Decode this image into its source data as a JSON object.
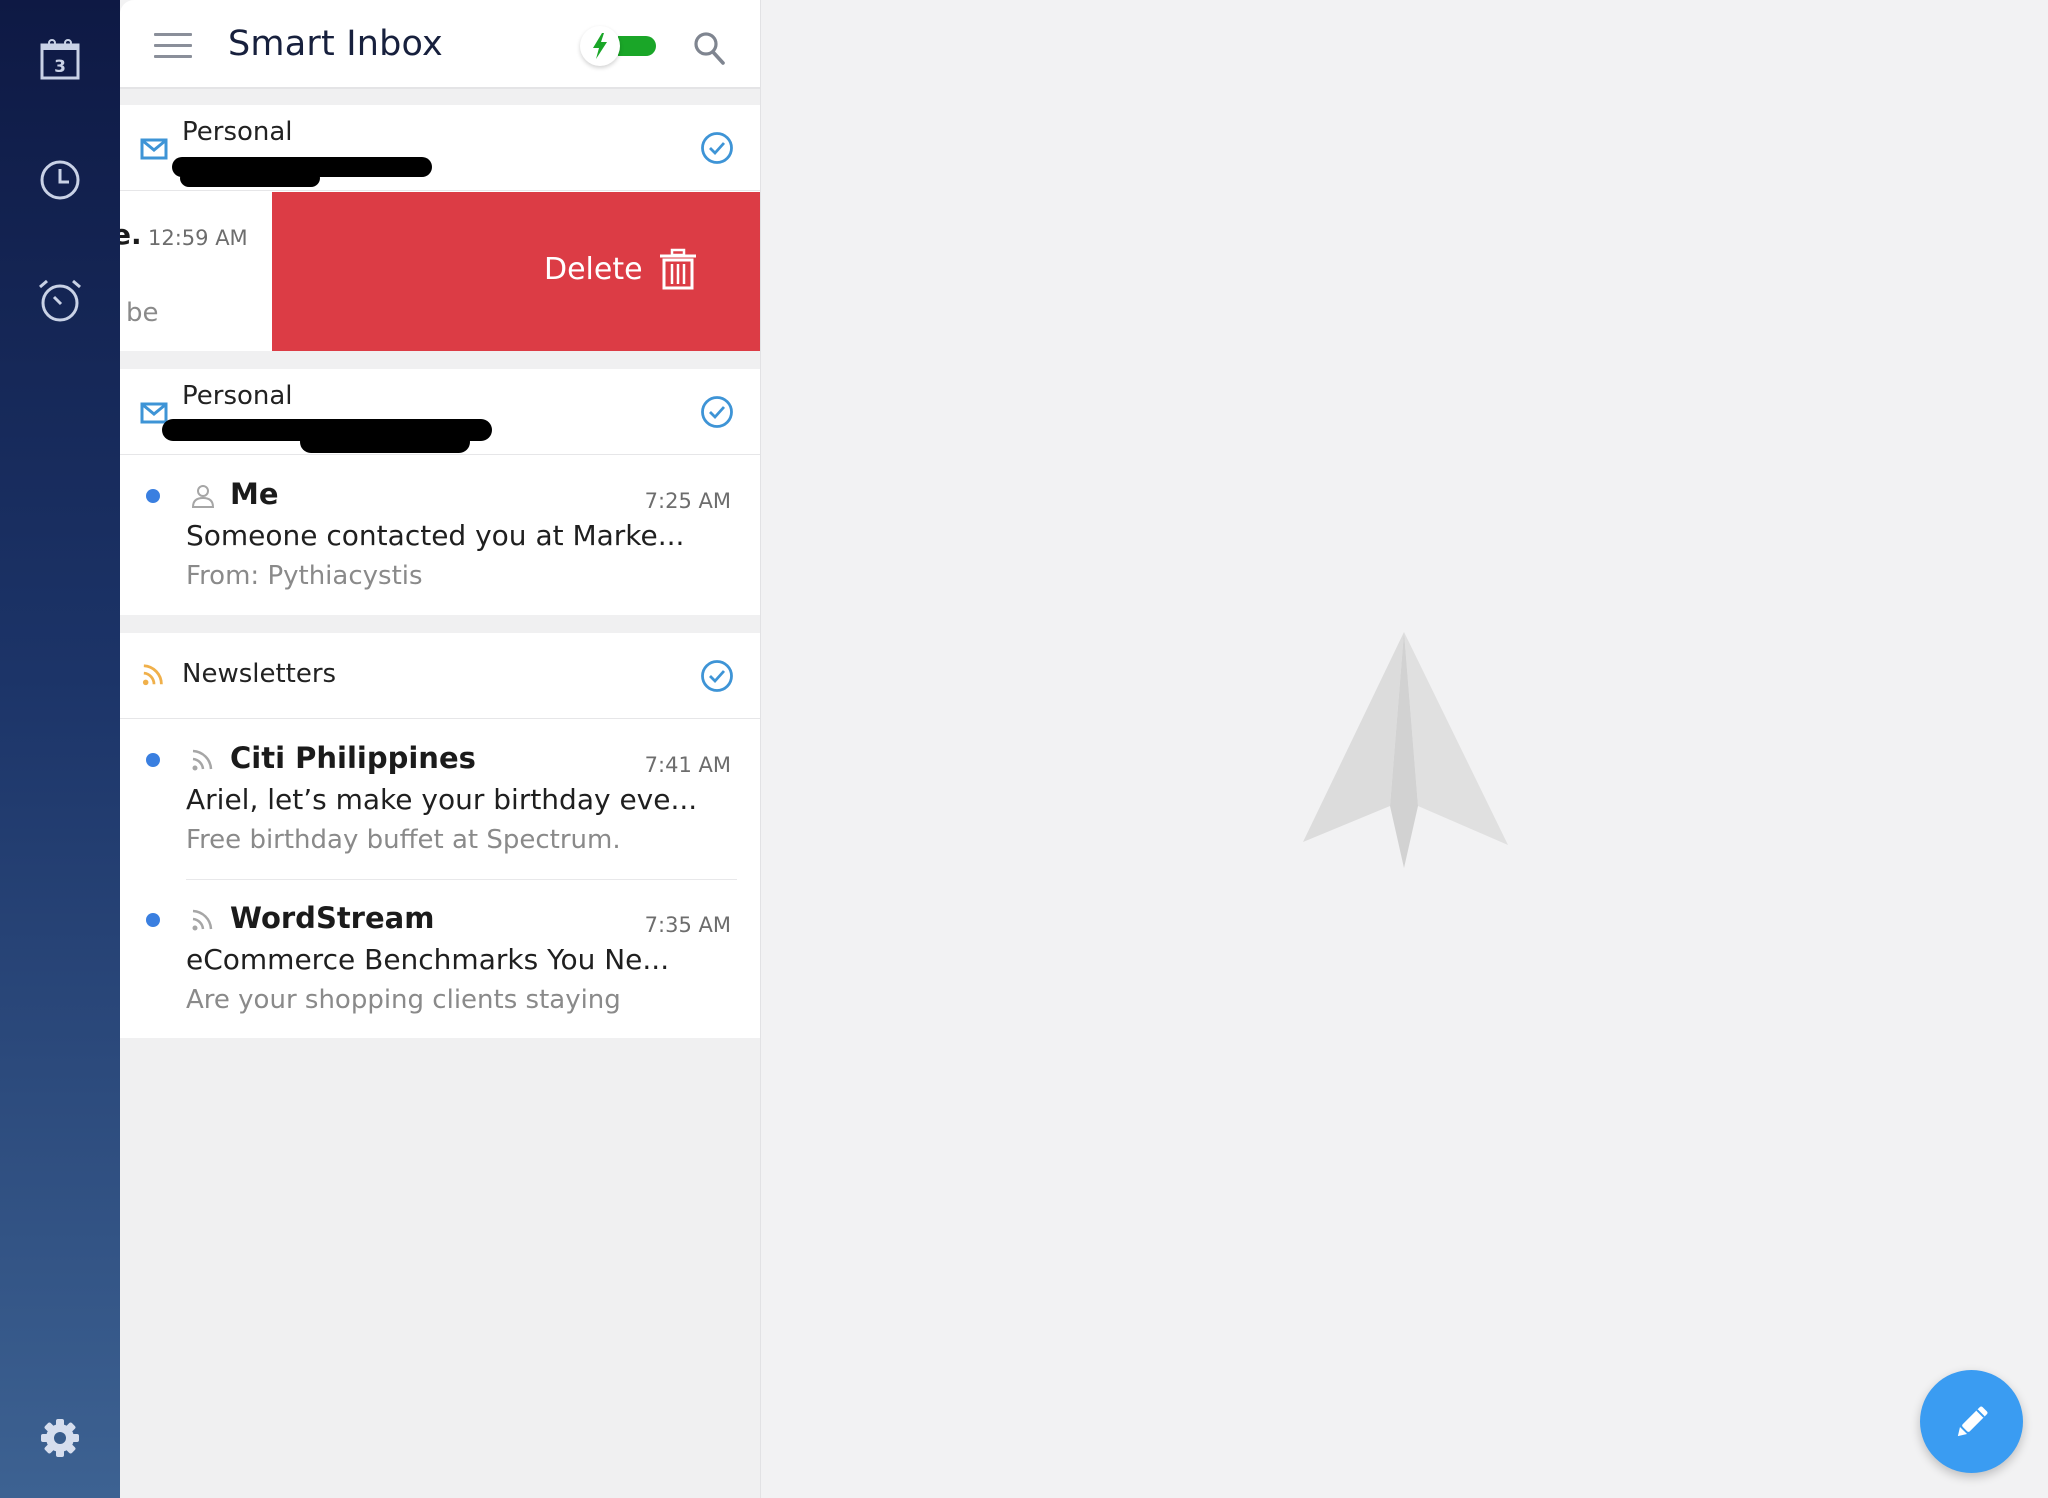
{
  "sidebar": {
    "calendar_day": "3",
    "items": [
      {
        "name": "calendar",
        "icon": "calendar-icon"
      },
      {
        "name": "recent",
        "icon": "clock-icon"
      },
      {
        "name": "reminders",
        "icon": "alarm-clock-icon"
      }
    ],
    "settings_icon": "gear-icon"
  },
  "header": {
    "title": "Smart Inbox",
    "menu_icon": "hamburger-menu-icon",
    "smart_toggle_icon": "lightning-bolt-icon",
    "smart_toggle_on": true,
    "search_icon": "search-icon"
  },
  "groups": [
    {
      "label": "Personal",
      "icon": "envelope-icon",
      "subtitle_redacted": true,
      "action_icon": "check-circle-icon",
      "swiped_item": {
        "sender_fragment": "e.",
        "time": "12:59 AM",
        "preview_fragment": "be",
        "delete_label": "Delete",
        "delete_icon": "trash-icon"
      }
    },
    {
      "label": "Personal",
      "icon": "envelope-icon",
      "subtitle_redacted": true,
      "action_icon": "check-circle-icon",
      "items": [
        {
          "unread": true,
          "kind_icon": "person-icon",
          "sender": "Me",
          "time": "7:25 AM",
          "subject": "Someone contacted you at Marke...",
          "preview": "From: Pythiacystis"
        }
      ]
    },
    {
      "label": "Newsletters",
      "icon": "rss-feed-icon",
      "action_icon": "check-circle-icon",
      "items": [
        {
          "unread": true,
          "kind_icon": "rss-feed-icon",
          "sender": "Citi Philippines",
          "time": "7:41 AM",
          "subject": "Ariel, let’s make your birthday eve...",
          "preview": "Free birthday buffet at Spectrum."
        },
        {
          "unread": true,
          "kind_icon": "rss-feed-icon",
          "sender": "WordStream",
          "time": "7:35 AM",
          "subject": "eCommerce Benchmarks You Ne...",
          "preview": "Are your shopping clients staying"
        }
      ]
    }
  ],
  "detail": {
    "placeholder_icon": "paper-plane-logo-icon"
  },
  "compose": {
    "icon": "pencil-icon"
  },
  "colors": {
    "accent_blue": "#3a9cf2",
    "unread_dot": "#3a7fe0",
    "delete_red": "#dc3c45",
    "toggle_green": "#1aa628",
    "newsletter_orange": "#f0b04a",
    "personal_blue": "#3e94d6"
  }
}
